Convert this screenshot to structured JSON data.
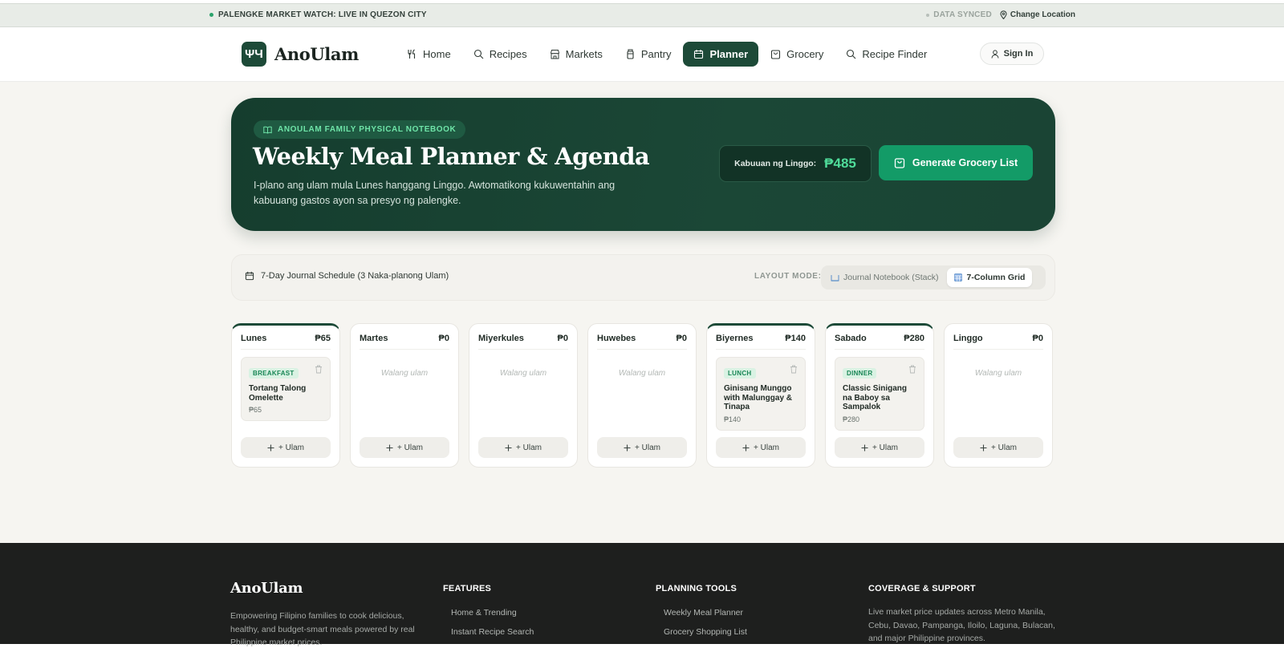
{
  "topbar": {
    "live_text": "PALENGKE MARKET WATCH: LIVE IN QUEZON CITY",
    "synced_text": "DATA SYNCED",
    "location_text": "Change Location"
  },
  "header": {
    "logo_glyph": "ΨЧ",
    "brand": "AnoUlam",
    "nav": [
      {
        "label": "Home",
        "icon": "utensils-icon"
      },
      {
        "label": "Recipes",
        "icon": "search-icon"
      },
      {
        "label": "Markets",
        "icon": "store-icon"
      },
      {
        "label": "Pantry",
        "icon": "jar-icon"
      },
      {
        "label": "Planner",
        "icon": "calendar-icon",
        "active": true
      },
      {
        "label": "Grocery",
        "icon": "bag-icon"
      },
      {
        "label": "Recipe Finder",
        "icon": "search-icon"
      }
    ],
    "signin": "Sign In"
  },
  "hero": {
    "badge": "ANOULAM FAMILY PHYSICAL NOTEBOOK",
    "title": "Weekly Meal Planner & Agenda",
    "description": "I-plano ang ulam mula Lunes hanggang Linggo. Awtomatikong kukuwentahin ang kabuuang gastos ayon sa presyo ng palengke.",
    "total_label": "Kabuuan ng Linggo:",
    "total_value": "₱485",
    "generate_button": "Generate Grocery List"
  },
  "schedule": {
    "title": "7-Day Journal Schedule (3 Naka-planong Ulam)",
    "layout_mode_label": "LAYOUT MODE:",
    "layout_options": [
      "Journal Notebook (Stack)",
      "7-Column Grid"
    ],
    "active_layout": "7-Column Grid"
  },
  "days": [
    {
      "name": "Lunes",
      "total": "₱65",
      "meal": {
        "tag": "BREAKFAST",
        "name": "Tortang Talong Omelette",
        "price": "₱65"
      }
    },
    {
      "name": "Martes",
      "total": "₱0",
      "empty": "Walang ulam"
    },
    {
      "name": "Miyerkules",
      "total": "₱0",
      "empty": "Walang ulam"
    },
    {
      "name": "Huwebes",
      "total": "₱0",
      "empty": "Walang ulam"
    },
    {
      "name": "Biyernes",
      "total": "₱140",
      "meal": {
        "tag": "LUNCH",
        "name": "Ginisang Munggo with Malunggay & Tinapa",
        "price": "₱140"
      }
    },
    {
      "name": "Sabado",
      "total": "₱280",
      "meal": {
        "tag": "DINNER",
        "name": "Classic Sinigang na Baboy sa Sampalok",
        "price": "₱280"
      }
    },
    {
      "name": "Linggo",
      "total": "₱0",
      "empty": "Walang ulam"
    }
  ],
  "add_label": "+ Ulam",
  "footer": {
    "brand": "AnoUlam",
    "description": "Empowering Filipino families to cook delicious, healthy, and budget-smart meals powered by real Philippine market prices.",
    "features": {
      "heading": "FEATURES",
      "links": [
        "Home & Trending",
        "Instant Recipe Search"
      ]
    },
    "planning": {
      "heading": "PLANNING TOOLS",
      "links": [
        "Weekly Meal Planner",
        "Grocery Shopping List"
      ]
    },
    "coverage": {
      "heading": "COVERAGE & SUPPORT",
      "text": "Live market price updates across Metro Manila, Cebu, Davao, Pampanga, Iloilo, Laguna, Bulacan, and major Philippine provinces."
    }
  },
  "colors": {
    "brand_green": "#1d4a38",
    "accent_green": "#139b67",
    "total_green": "#4fdc9a"
  }
}
